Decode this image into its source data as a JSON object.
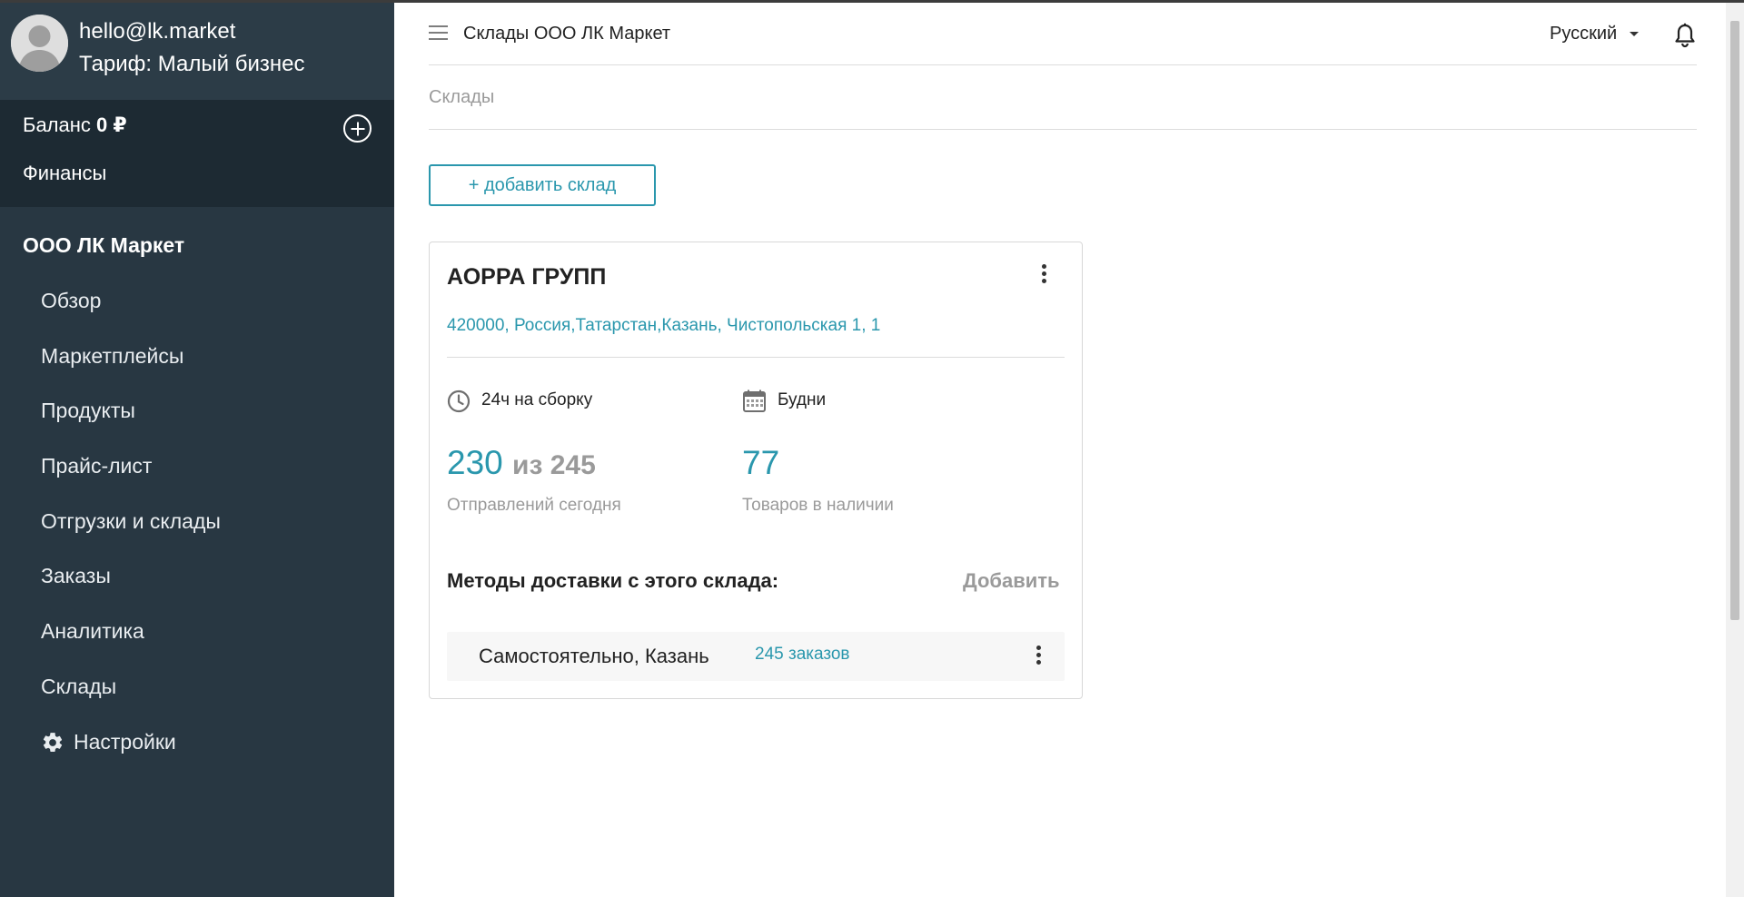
{
  "profile": {
    "email": "hello@lk.market",
    "tariff": "Тариф: Малый бизнес"
  },
  "balance": {
    "label": "Баланс",
    "amount": "0 ₽",
    "finances_label": "Финансы"
  },
  "sidebar": {
    "org_title": "ООО ЛК Маркет",
    "items": [
      {
        "label": "Обзор"
      },
      {
        "label": "Маркетплейсы"
      },
      {
        "label": "Продукты"
      },
      {
        "label": "Прайс-лист"
      },
      {
        "label": "Отгрузки и склады"
      },
      {
        "label": "Заказы"
      },
      {
        "label": "Аналитика"
      },
      {
        "label": "Склады"
      },
      {
        "label": "Настройки",
        "icon": "gear-icon"
      }
    ]
  },
  "header": {
    "title": "Склады ООО ЛК Маркет",
    "language": "Русский",
    "breadcrumb": "Склады"
  },
  "actions": {
    "add_warehouse": "+ добавить склад"
  },
  "warehouse": {
    "name": "АОРРА ГРУПП",
    "address": "420000, Россия,Татарстан,Казань, Чистопольская 1, 1",
    "assembly_time": "24ч на сборку",
    "schedule": "Будни",
    "shipments_today": "230",
    "shipments_of": "из 245",
    "shipments_label": "Отправлений сегодня",
    "in_stock": "77",
    "in_stock_label": "Товаров в наличии",
    "methods_title": "Методы доставки с этого склада:",
    "methods_add": "Добавить",
    "methods": [
      {
        "name": "Самостоятельно, Казань",
        "orders": "245 заказов"
      }
    ]
  },
  "colors": {
    "sidebar_bg": "#283742",
    "accent": "#2a97ad",
    "muted": "#9a9a9a"
  }
}
